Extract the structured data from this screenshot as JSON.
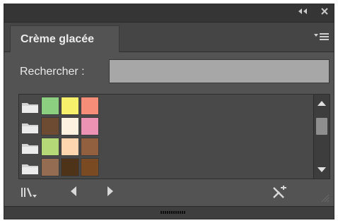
{
  "panel": {
    "tab_title": "Crème glacée",
    "collapse_icon": "double-chevron-left-icon",
    "close_icon": "close-icon",
    "menu_icon": "panel-menu-icon"
  },
  "search": {
    "label": "Rechercher :",
    "value": ""
  },
  "swatch_rows": [
    {
      "colors": [
        "#8dcf81",
        "#f6f06a",
        "#f68d78"
      ]
    },
    {
      "colors": [
        "#6d4a32",
        "#fdf2df",
        "#ec92b3"
      ]
    },
    {
      "colors": [
        "#b5d976",
        "#fdd6b0",
        "#93603f"
      ]
    },
    {
      "colors": [
        "#946c52",
        "#4f3318",
        "#7a4a22"
      ]
    }
  ],
  "toolbar": {
    "library_icon": "swatch-libraries-menu-icon",
    "prev_icon": "previous-library-icon",
    "next_icon": "next-library-icon",
    "add_icon": "add-to-swatches-icon"
  }
}
